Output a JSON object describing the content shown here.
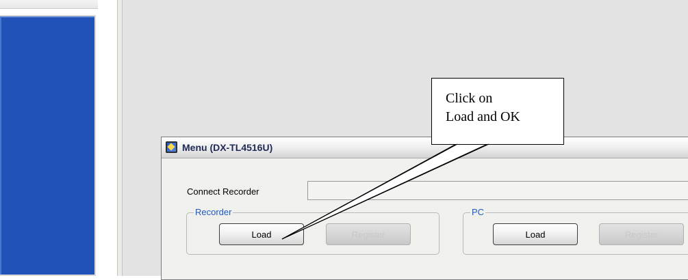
{
  "dialog": {
    "title": "Menu (DX-TL4516U)",
    "connect_label": "Connect Recorder",
    "connect_value": "",
    "recorder_group": {
      "legend": "Recorder",
      "load_label": "Load",
      "register_label": "Register"
    },
    "pc_group": {
      "legend": "PC",
      "load_label": "Load",
      "register_label": "Register"
    }
  },
  "callout": {
    "line1": "Click on",
    "line2": "Load and OK"
  },
  "colors": {
    "left_panel": "#2152b8",
    "background": "#e3e3e3",
    "legend_text": "#1f59c4"
  }
}
